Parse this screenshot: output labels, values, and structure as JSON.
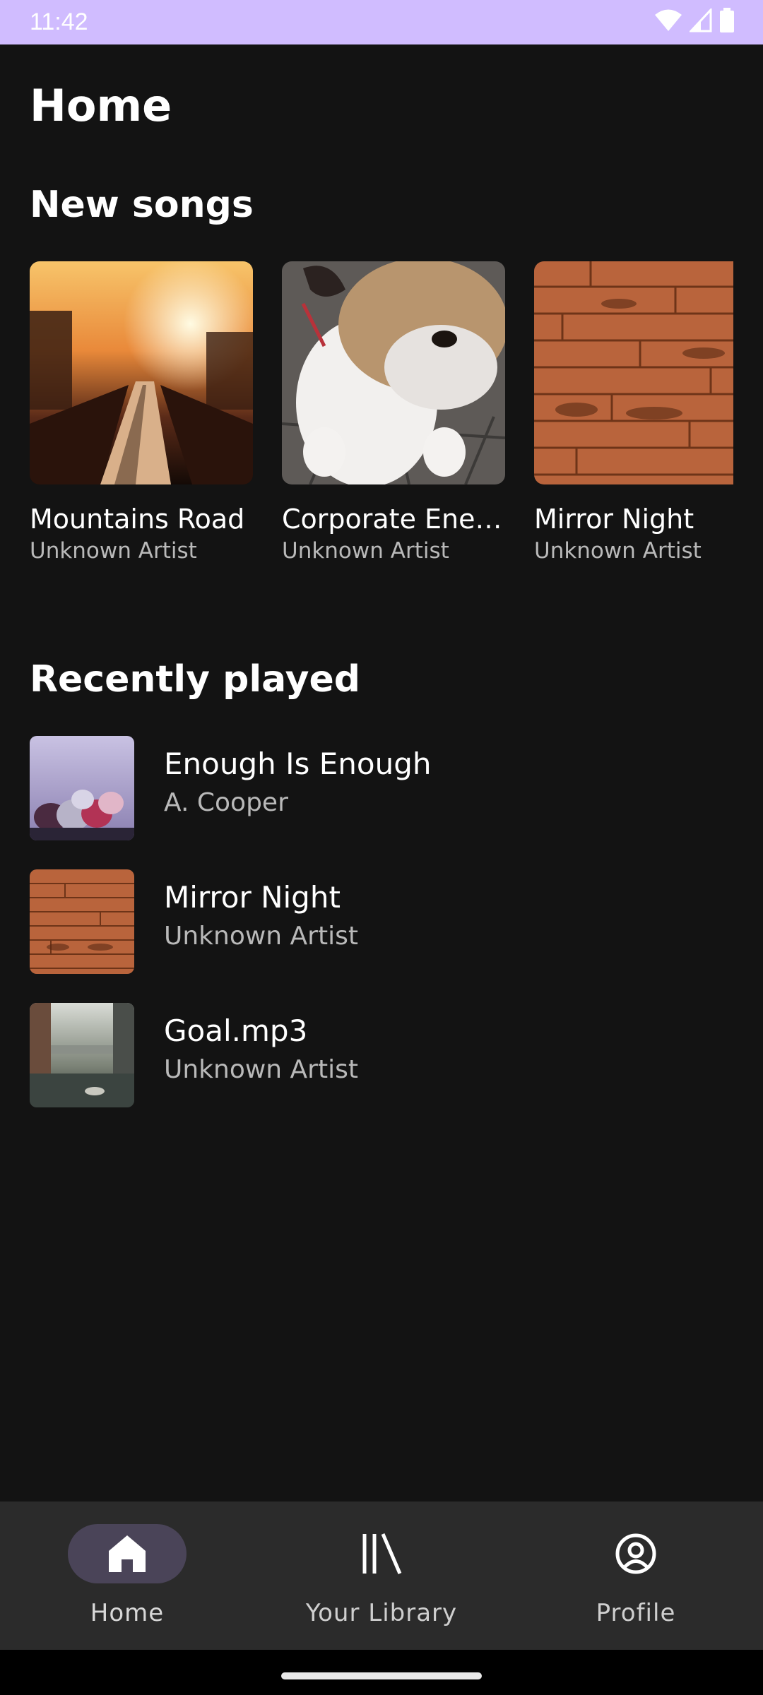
{
  "status_bar": {
    "time": "11:42",
    "icons": [
      "wifi-icon",
      "cell-signal-icon",
      "battery-icon"
    ],
    "background": "#d0bcff"
  },
  "page": {
    "title": "Home"
  },
  "new_songs": {
    "heading": "New songs",
    "items": [
      {
        "title": "Mountains Road",
        "artist": "Unknown Artist",
        "art": "sunset-city-road-image"
      },
      {
        "title": "Corporate Energ…",
        "artist": "Unknown Artist",
        "art": "bulldog-image"
      },
      {
        "title": "Mirror Night",
        "artist": "Unknown Artist",
        "art": "wood-planks-image"
      }
    ]
  },
  "recently_played": {
    "heading": "Recently played",
    "items": [
      {
        "title": "Enough Is Enough",
        "artist": "A. Cooper",
        "art": "frozen-berries-image"
      },
      {
        "title": "Mirror Night",
        "artist": "Unknown Artist",
        "art": "wood-planks-image"
      },
      {
        "title": "Goal.mp3",
        "artist": "Unknown Artist",
        "art": "canal-city-image"
      }
    ]
  },
  "bottom_nav": {
    "items": [
      {
        "label": "Home",
        "icon": "home-icon",
        "active": true
      },
      {
        "label": "Your Library",
        "icon": "library-icon",
        "active": false
      },
      {
        "label": "Profile",
        "icon": "profile-icon",
        "active": false
      }
    ],
    "active_indicator_color": "#4a4458"
  },
  "colors": {
    "background": "#131313",
    "nav_background": "#2b2b2b",
    "secondary_text": "#b9b9b9"
  }
}
